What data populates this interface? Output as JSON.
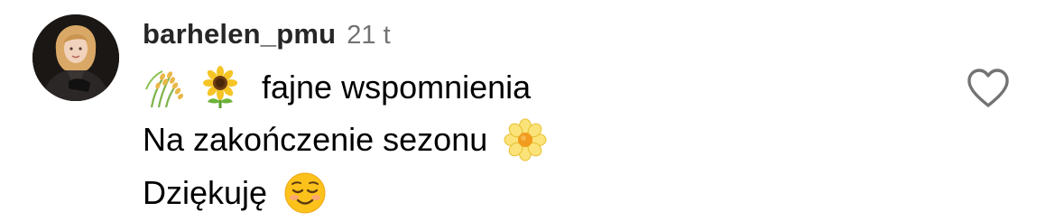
{
  "comment": {
    "username": "barhelen_pmu",
    "timestamp": "21 t",
    "lines": [
      {
        "emojis": [
          "rice-sheaf-emoji",
          "sunflower-emoji"
        ],
        "text": "fajne wspomnienia"
      },
      {
        "text": "Na zakończenie sezonu",
        "emojis": [
          "blossom-emoji"
        ]
      },
      {
        "text": "Dziękuję",
        "emojis": [
          "smiling-face-emoji"
        ]
      }
    ],
    "like_icon": "heart-outline-icon",
    "avatar_icon": "profile-avatar"
  }
}
